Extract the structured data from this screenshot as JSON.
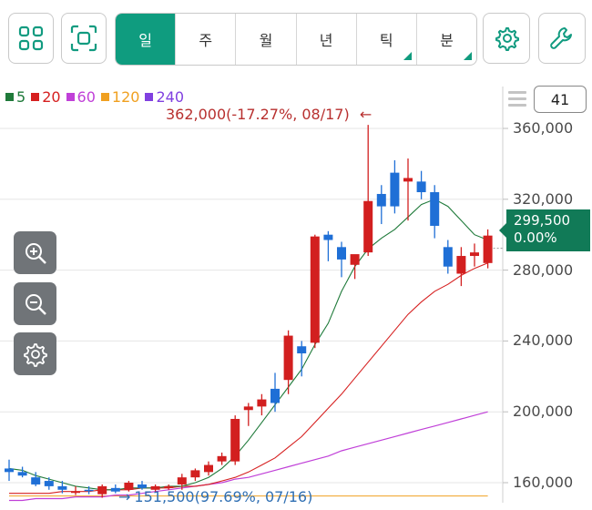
{
  "toolbar": {
    "layout_icon": "grid-four-squares-icon",
    "expand_icon": "focus-frame-icon",
    "settings_icon": "gear-icon",
    "tools_icon": "wrench-icon"
  },
  "periods": [
    {
      "label": "일",
      "active": true,
      "submenu": false
    },
    {
      "label": "주",
      "active": false,
      "submenu": false
    },
    {
      "label": "월",
      "active": false,
      "submenu": false
    },
    {
      "label": "년",
      "active": false,
      "submenu": false
    },
    {
      "label": "틱",
      "active": false,
      "submenu": true
    },
    {
      "label": "분",
      "active": false,
      "submenu": true
    }
  ],
  "legend": [
    {
      "label": "5",
      "color": "#1f7a3a"
    },
    {
      "label": "20",
      "color": "#d62020"
    },
    {
      "label": "60",
      "color": "#c040d8"
    },
    {
      "label": "120",
      "color": "#f0a020"
    },
    {
      "label": "240",
      "color": "#8040e0"
    }
  ],
  "annotations": {
    "high": "362,000(-17.27%, 08/17)",
    "high_arrow": "←",
    "low": "151,500(97.69%, 07/16)",
    "low_arrow": "→"
  },
  "candle_count": "41",
  "current_price": {
    "price": "299,500",
    "change": "0.00%"
  },
  "side_controls": {
    "zoom_in": "zoom-in-icon",
    "zoom_out": "zoom-out-icon",
    "settings": "gear-icon"
  },
  "colors": {
    "up": "#d21f1f",
    "down": "#1f6fd6",
    "accent": "#0f9c7f",
    "price_tag": "#117a57"
  },
  "chart_data": {
    "type": "candlestick",
    "y_ticks": [
      "360,000",
      "320,000",
      "280,000",
      "240,000",
      "200,000",
      "160,000"
    ],
    "y_tick_values": [
      360000,
      320000,
      280000,
      240000,
      200000,
      160000
    ],
    "ylim": [
      155000,
      372000
    ],
    "grid": true,
    "candles": [
      {
        "o": 168000,
        "h": 173000,
        "l": 161000,
        "c": 166000
      },
      {
        "o": 166000,
        "h": 169000,
        "l": 163000,
        "c": 164000
      },
      {
        "o": 163000,
        "h": 166000,
        "l": 158000,
        "c": 159000
      },
      {
        "o": 161000,
        "h": 163000,
        "l": 156000,
        "c": 158000
      },
      {
        "o": 158000,
        "h": 161000,
        "l": 154000,
        "c": 156000
      },
      {
        "o": 155000,
        "h": 158000,
        "l": 153000,
        "c": 155000
      },
      {
        "o": 156000,
        "h": 158000,
        "l": 153500,
        "c": 155500
      },
      {
        "o": 153500,
        "h": 159000,
        "l": 151500,
        "c": 158000
      },
      {
        "o": 157000,
        "h": 159000,
        "l": 154000,
        "c": 155000
      },
      {
        "o": 156000,
        "h": 161000,
        "l": 155000,
        "c": 160000
      },
      {
        "o": 159000,
        "h": 161000,
        "l": 156000,
        "c": 157000
      },
      {
        "o": 156000,
        "h": 159000,
        "l": 155000,
        "c": 158000
      },
      {
        "o": 157000,
        "h": 159000,
        "l": 156000,
        "c": 158000
      },
      {
        "o": 159000,
        "h": 165000,
        "l": 156000,
        "c": 163000
      },
      {
        "o": 163000,
        "h": 168000,
        "l": 161000,
        "c": 167000
      },
      {
        "o": 166000,
        "h": 172000,
        "l": 164000,
        "c": 170000
      },
      {
        "o": 172000,
        "h": 177000,
        "l": 170000,
        "c": 175000
      },
      {
        "o": 172000,
        "h": 198000,
        "l": 170000,
        "c": 196000
      },
      {
        "o": 201000,
        "h": 205000,
        "l": 192000,
        "c": 203000
      },
      {
        "o": 203000,
        "h": 210000,
        "l": 198000,
        "c": 207000
      },
      {
        "o": 213000,
        "h": 222000,
        "l": 200000,
        "c": 205000
      },
      {
        "o": 218000,
        "h": 246000,
        "l": 210000,
        "c": 243000
      },
      {
        "o": 237000,
        "h": 240000,
        "l": 220000,
        "c": 233000
      },
      {
        "o": 239000,
        "h": 300000,
        "l": 236000,
        "c": 299000
      },
      {
        "o": 300000,
        "h": 302000,
        "l": 285000,
        "c": 297000
      },
      {
        "o": 293000,
        "h": 296000,
        "l": 276000,
        "c": 286000
      },
      {
        "o": 283000,
        "h": 288000,
        "l": 275000,
        "c": 289000
      },
      {
        "o": 290000,
        "h": 362000,
        "l": 288000,
        "c": 319000
      },
      {
        "o": 323000,
        "h": 328000,
        "l": 306000,
        "c": 316000
      },
      {
        "o": 335000,
        "h": 342000,
        "l": 312000,
        "c": 316000
      },
      {
        "o": 330000,
        "h": 343000,
        "l": 308000,
        "c": 332000
      },
      {
        "o": 330000,
        "h": 336000,
        "l": 320000,
        "c": 324000
      },
      {
        "o": 324000,
        "h": 328000,
        "l": 298000,
        "c": 305000
      },
      {
        "o": 293000,
        "h": 297000,
        "l": 278000,
        "c": 282000
      },
      {
        "o": 278000,
        "h": 293000,
        "l": 271000,
        "c": 288000
      },
      {
        "o": 288000,
        "h": 295000,
        "l": 282000,
        "c": 290000
      },
      {
        "o": 284000,
        "h": 303000,
        "l": 281000,
        "c": 299500
      }
    ],
    "ma5": [
      168000,
      167000,
      164000,
      162000,
      160000,
      158000,
      157000,
      156000,
      156000,
      157000,
      157000,
      157000,
      158000,
      158000,
      160000,
      163000,
      168000,
      175000,
      184000,
      194000,
      204000,
      214000,
      224000,
      238000,
      250000,
      268000,
      282000,
      292000,
      298000,
      303000,
      310000,
      317000,
      320000,
      316000,
      308000,
      300000,
      297000
    ],
    "ma20": [
      154000,
      154000,
      154000,
      154000,
      155000,
      155000,
      155000,
      156000,
      156000,
      156000,
      157000,
      157000,
      157000,
      158000,
      158000,
      159000,
      161000,
      163000,
      166000,
      170000,
      174000,
      180000,
      186000,
      194000,
      202000,
      210000,
      219000,
      228000,
      237000,
      246000,
      255000,
      262000,
      268000,
      272000,
      277000,
      281000,
      284000
    ],
    "ma60": [
      150000,
      150000,
      151000,
      151000,
      151000,
      152000,
      152000,
      152000,
      153000,
      153000,
      154000,
      155000,
      156000,
      157000,
      158000,
      159000,
      160000,
      162000,
      163000,
      165000,
      167000,
      169000,
      171000,
      173000,
      175000,
      178000,
      180000,
      182000,
      184000,
      186000,
      188000,
      190000,
      192000,
      194000,
      196000,
      198000,
      200000
    ],
    "ma120": [
      152500,
      152500,
      152500,
      152500,
      152500,
      152500,
      152500,
      152500,
      152500,
      152500,
      152500,
      152500,
      152500,
      152500,
      152500,
      152500,
      152500,
      152500,
      152500,
      152500,
      152500,
      152500,
      152500,
      152500,
      152500,
      152500,
      152500,
      152500,
      152500,
      152500,
      152500,
      152500,
      152500,
      152500,
      152500,
      152500,
      152500
    ]
  }
}
